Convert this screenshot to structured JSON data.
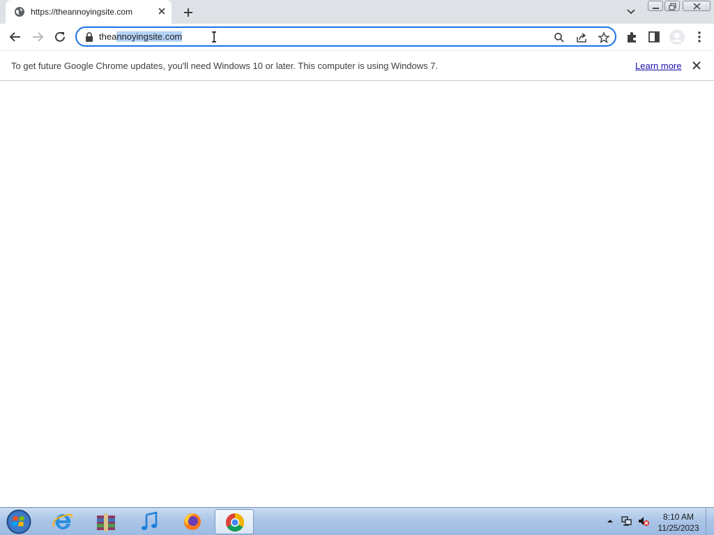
{
  "tab": {
    "title": "https://theannoyingsite.com",
    "favicon": "globe-icon"
  },
  "omnibox": {
    "url_prefix": "thea",
    "url_selected": "nnoyingsite.com"
  },
  "infobar": {
    "message": "To get future Google Chrome updates, you'll need Windows 10 or later. This computer is using Windows 7.",
    "link": "Learn more"
  },
  "taskbar": {
    "apps": [
      {
        "name": "Internet Explorer",
        "icon": "ie-icon"
      },
      {
        "name": "WinRAR",
        "icon": "archive-icon"
      },
      {
        "name": "iTunes",
        "icon": "music-note-icon"
      },
      {
        "name": "Firefox",
        "icon": "firefox-icon"
      },
      {
        "name": "Google Chrome",
        "icon": "chrome-icon",
        "active": true
      }
    ],
    "time": "8:10 AM",
    "date": "11/25/2023"
  },
  "colors": {
    "accent": "#1a73e8",
    "selection": "#b4d3f5",
    "tabstrip": "#dee1e6",
    "taskbar": "#a9c4e6"
  }
}
